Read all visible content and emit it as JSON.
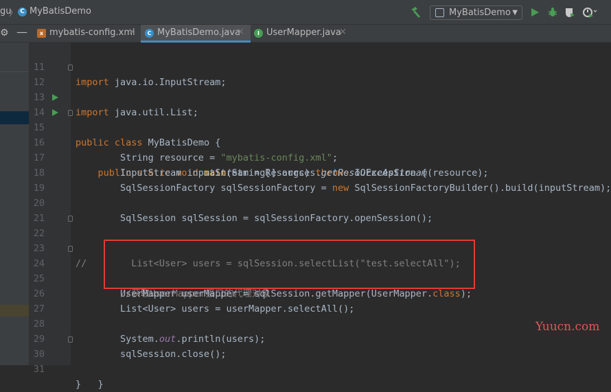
{
  "toolbar": {
    "breadcrumb_partial": "gu",
    "breadcrumb_separator": "〉",
    "project_name": "MyBatisDemo",
    "run_config_label": "MyBatisDemo",
    "app_icon_letter": "C"
  },
  "tabs": [
    {
      "label": "mybatis-config.xml",
      "icon": "xml-file-icon",
      "active": false
    },
    {
      "label": "MyBatisDemo.java",
      "icon": "java-class-icon",
      "active": true
    },
    {
      "label": "UserMapper.java",
      "icon": "java-interface-icon",
      "active": false
    }
  ],
  "tab_close_glyph": "×",
  "tab_icon_letters": {
    "class": "C",
    "interface": "I",
    "xml": "x"
  },
  "editor": {
    "lines": [
      {
        "num": "11",
        "text": "import java.io.InputStream;"
      },
      {
        "num": "12",
        "text": "import java.util.List;"
      },
      {
        "num": "13",
        "text": ""
      },
      {
        "num": "14",
        "text": "public class MyBatisDemo {"
      },
      {
        "num": "15",
        "text": "    public static void main(String[] args) throws IOException {"
      },
      {
        "num": "16",
        "text": "        String resource = \"mybatis-config.xml\";"
      },
      {
        "num": "17",
        "text": "        InputStream inputStream = Resources.getResourceAsStream(resource);"
      },
      {
        "num": "18",
        "text": "        SqlSessionFactory sqlSessionFactory = new SqlSessionFactoryBuilder().build(inputStream);"
      },
      {
        "num": "19",
        "text": ""
      },
      {
        "num": "20",
        "text": "        SqlSession sqlSession = sqlSessionFactory.openSession();"
      },
      {
        "num": "21",
        "text": ""
      },
      {
        "num": "22",
        "text": "//        List<User> users = sqlSession.selectList(\"test.selectAll\");"
      },
      {
        "num": "23",
        "text": ""
      },
      {
        "num": "24",
        "text": "        //获取UserMapper接口的代理对象"
      },
      {
        "num": "25",
        "text": "        UserMapper userMapper = sqlSession.getMapper(UserMapper.class);"
      },
      {
        "num": "26",
        "text": "        List<User> users = userMapper.selectAll();"
      },
      {
        "num": "27",
        "text": ""
      },
      {
        "num": "28",
        "text": "        System.out.println(users);"
      },
      {
        "num": "29",
        "text": "        sqlSession.close();"
      },
      {
        "num": "30",
        "text": "    }"
      },
      {
        "num": "31",
        "text": "}"
      }
    ]
  },
  "watermark": "Yuucn.com",
  "colors": {
    "keyword": "#cc7832",
    "string": "#6a8759",
    "method_decl": "#ffc66d",
    "comment": "#808080",
    "static_field": "#9876aa",
    "default_text": "#a9b7c6",
    "highlight_box": "#e63a3a",
    "run_green": "#499c54"
  }
}
